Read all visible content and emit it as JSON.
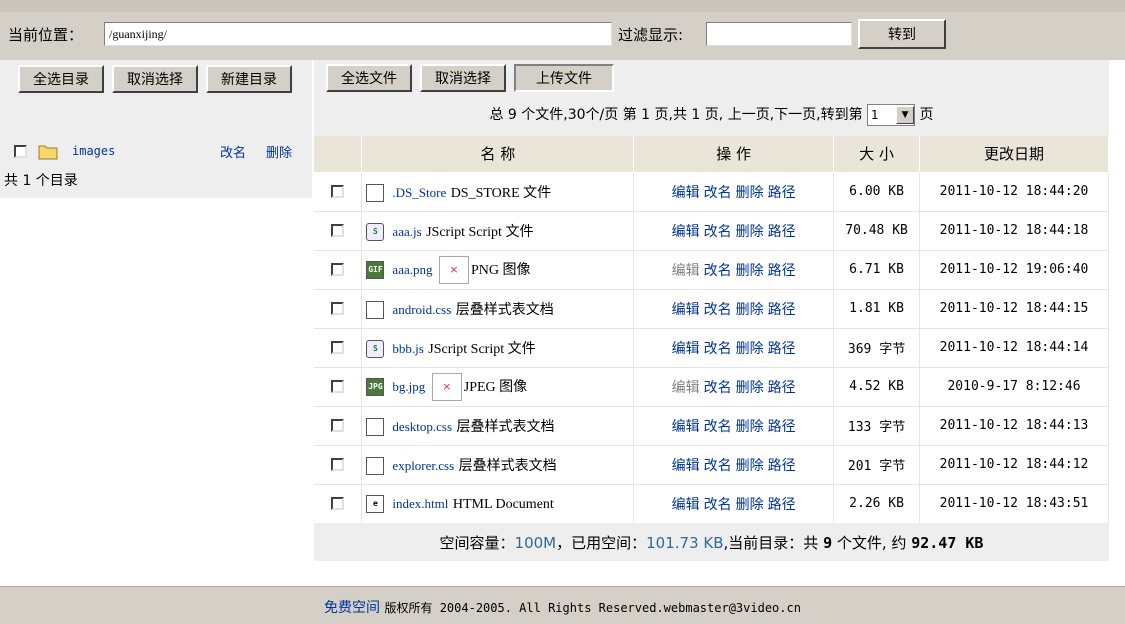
{
  "topbar": {
    "location_label": "当前位置：",
    "path_value": "/guanxijing/",
    "filter_label": "过滤显示:",
    "filter_value": "",
    "goto_button": "转到"
  },
  "left": {
    "toolbar": {
      "select_all_dirs": "全选目录",
      "cancel_select": "取消选择",
      "new_dir": "新建目录"
    },
    "dirs": [
      {
        "name": "images",
        "rename": "改名",
        "delete": "删除"
      }
    ],
    "dir_count": "共 1 个目录"
  },
  "right": {
    "toolbar": {
      "select_all_files": "全选文件",
      "cancel_select": "取消选择",
      "upload": "上传文件"
    },
    "pager": {
      "text": "总 9 个文件,30个/页 第 1 页,共 1 页, 上一页,下一页,转到第",
      "page_value": "1",
      "suffix": "页"
    },
    "columns": {
      "name": "名 称",
      "ops": "操 作",
      "size": "大 小",
      "date": "更改日期"
    },
    "ops_labels": {
      "edit": "编辑",
      "rename": "改名",
      "delete": "删除",
      "path": "路径"
    },
    "files": [
      {
        "icon": "document-icon",
        "name": ".DS_Store",
        "type": "DS_STORE 文件",
        "editable": true,
        "size": "6.00 KB",
        "date": "2011-10-12 18:44:20"
      },
      {
        "icon": "script-icon",
        "name": "aaa.js",
        "type": "JScript Script 文件",
        "editable": true,
        "size": "70.48 KB",
        "date": "2011-10-12 18:44:18"
      },
      {
        "icon": "gif-image-icon",
        "name": "aaa.png",
        "type": "PNG 图像",
        "thumb": true,
        "editable": false,
        "size": "6.71 KB",
        "date": "2011-10-12 19:06:40"
      },
      {
        "icon": "document-icon",
        "name": "android.css",
        "type": "层叠样式表文档",
        "editable": true,
        "size": "1.81 KB",
        "date": "2011-10-12 18:44:15"
      },
      {
        "icon": "script-icon",
        "name": "bbb.js",
        "type": "JScript Script 文件",
        "editable": true,
        "size": "369 字节",
        "date": "2011-10-12 18:44:14"
      },
      {
        "icon": "jpeg-image-icon",
        "name": "bg.jpg",
        "type": "JPEG 图像",
        "thumb": true,
        "editable": false,
        "size": "4.52 KB",
        "date": "2010-9-17 8:12:46"
      },
      {
        "icon": "document-icon",
        "name": "desktop.css",
        "type": "层叠样式表文档",
        "editable": true,
        "size": "133 字节",
        "date": "2011-10-12 18:44:13"
      },
      {
        "icon": "document-icon",
        "name": "explorer.css",
        "type": "层叠样式表文档",
        "editable": true,
        "size": "201 字节",
        "date": "2011-10-12 18:44:12"
      },
      {
        "icon": "html-document-icon",
        "name": "index.html",
        "type": "HTML Document",
        "editable": true,
        "size": "2.26 KB",
        "date": "2011-10-12 18:43:51"
      }
    ],
    "summary": {
      "label_capacity": "空间容量：",
      "capacity": "100M",
      "label_used": "，已用空间：",
      "used": "101.73 KB",
      "label_dir": ",当前目录：共",
      "file_count": "9",
      "label_files": "个文件, 约",
      "dir_size": "92.47 KB"
    }
  },
  "footer": {
    "link": "免费空间",
    "text": "版权所有 2004-2005. All Rights Reserved.webmaster@3video.cn"
  }
}
